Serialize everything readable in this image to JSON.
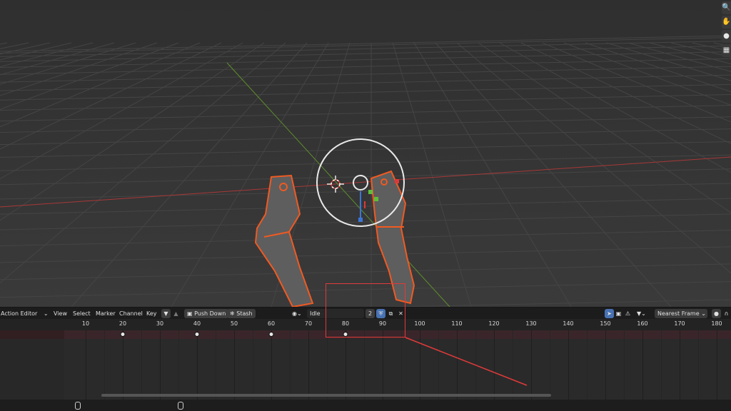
{
  "header": {
    "editor_label": "Action Editor",
    "menus": [
      "View",
      "Select",
      "Marker",
      "Channel",
      "Key"
    ],
    "push_down_label": "Push Down",
    "stash_label": "Stash",
    "action_name": "Idle",
    "user_count": "2",
    "snapping_label": "Nearest Frame"
  },
  "ruler": {
    "ticks": [
      "10",
      "20",
      "30",
      "40",
      "50",
      "60",
      "70",
      "80",
      "90",
      "100",
      "110",
      "120",
      "130",
      "140",
      "150",
      "160",
      "170",
      "180"
    ]
  },
  "keyframes": [
    20,
    40,
    60,
    80
  ],
  "colors": {
    "accent_select": "#4772b3",
    "annotation": "#e03a3a",
    "bone_outline": "#f05a22",
    "grid_red_axis": "#a83838",
    "grid_green_axis": "#5f8f2c"
  },
  "icons": [
    "search-icon",
    "hand-icon",
    "camera-icon",
    "grid-icon",
    "chevron-down-icon",
    "filter-icon",
    "shield-icon",
    "copy-icon",
    "close-icon",
    "snowflake-icon",
    "cursor-icon",
    "warning-icon",
    "mouse-icon",
    "swap-icon"
  ]
}
